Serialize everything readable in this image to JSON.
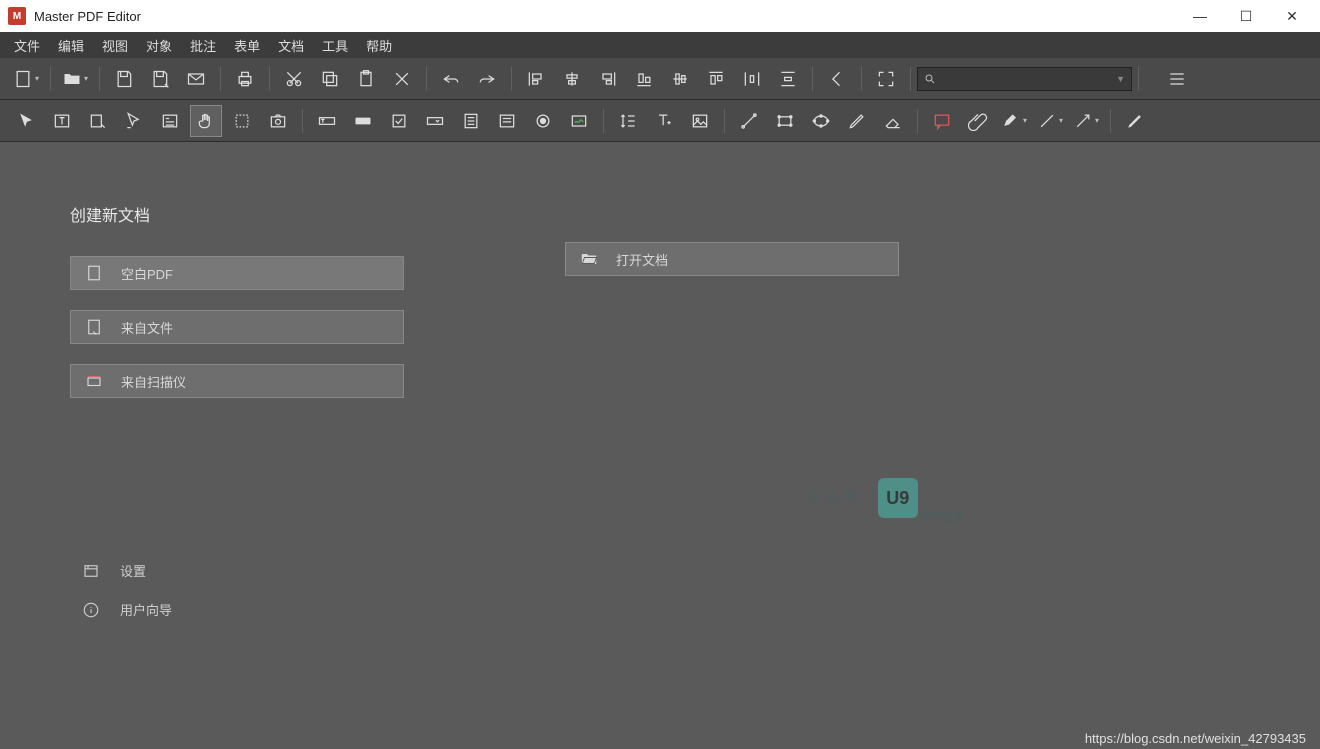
{
  "title": "Master PDF Editor",
  "menu": [
    "文件",
    "编辑",
    "视图",
    "对象",
    "批注",
    "表单",
    "文档",
    "工具",
    "帮助"
  ],
  "start": {
    "heading": "创建新文档",
    "blank": "空白PDF",
    "fromFile": "来自文件",
    "fromScanner": "来自扫描仪",
    "open": "打开文档"
  },
  "links": {
    "settings": "设置",
    "guide": "用户向导"
  },
  "watermark": {
    "label": "公 众 号：",
    "badge": "U9",
    "sub": "软件宝库"
  },
  "status": "https://blog.csdn.net/weixin_42793435"
}
